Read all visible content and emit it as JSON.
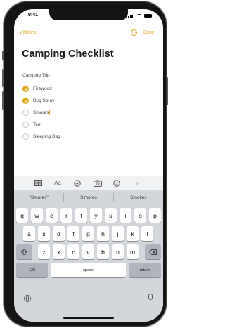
{
  "status": {
    "time": "9:41"
  },
  "nav": {
    "back_label": "Notes",
    "done_label": "Done",
    "accent": "#e0a81d"
  },
  "note": {
    "title": "Camping Checklist",
    "section_heading": "Camping Trip",
    "items": [
      {
        "label": "Firewood",
        "checked": true
      },
      {
        "label": "Bug Spray",
        "checked": true
      },
      {
        "label": "Smores",
        "checked": false
      },
      {
        "label": "Tent",
        "checked": false
      },
      {
        "label": "Sleeping Bag",
        "checked": false
      }
    ]
  },
  "format_bar": {
    "items": [
      "table-icon",
      "text-format-icon",
      "checklist-icon",
      "camera-icon",
      "markup-icon",
      "close-icon"
    ],
    "text_format_label": "Aa"
  },
  "suggestions": [
    "\"Smores\"",
    "S'mores",
    "Smokes"
  ],
  "keyboard": {
    "row1": [
      "q",
      "w",
      "e",
      "r",
      "t",
      "y",
      "u",
      "i",
      "o",
      "p"
    ],
    "row2": [
      "a",
      "s",
      "d",
      "f",
      "g",
      "h",
      "j",
      "k",
      "l"
    ],
    "row3": [
      "z",
      "x",
      "c",
      "v",
      "b",
      "n",
      "m"
    ],
    "numbers_label": "123",
    "space_label": "space",
    "return_label": "return"
  }
}
